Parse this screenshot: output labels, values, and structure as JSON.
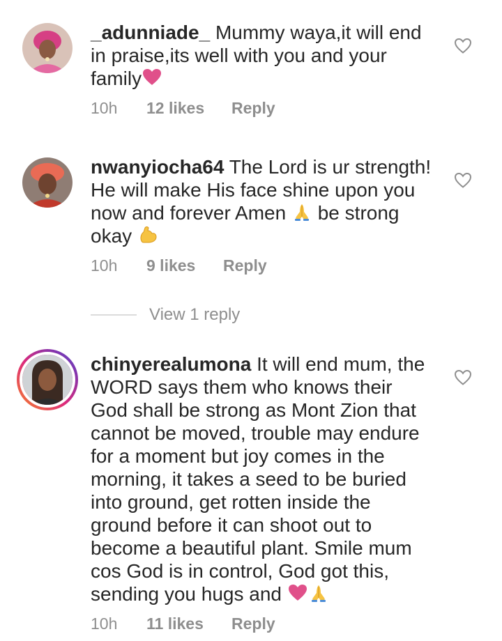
{
  "comments": [
    {
      "username": "_adunniade_",
      "text": "Mummy waya,it will end in praise,its well with you and your family",
      "time": "10h",
      "likes": "12 likes",
      "reply": "Reply"
    },
    {
      "username": "nwanyiocha64",
      "text_a": "The Lord is ur strength! He will make His face shine upon you now and forever Amen",
      "text_b": "be strong okay",
      "time": "10h",
      "likes": "9 likes",
      "reply": "Reply",
      "view_replies": "View 1 reply"
    },
    {
      "username": "chinyerealumona",
      "text": "It will end mum, the WORD says them who knows their God shall be strong as Mont Zion that cannot be moved, trouble may endure for a moment but joy comes in the morning, it takes a seed to be buried into ground, get rotten inside the ground before it can shoot out to become a beautiful plant. Smile mum cos God is in control, God got this, sending you hugs and",
      "time": "10h",
      "likes": "11 likes",
      "reply": "Reply"
    }
  ],
  "icons": {
    "like": "heart-outline-icon",
    "heart_emoji": "heart-emoji",
    "pray_emoji": "folded-hands-emoji",
    "muscle_emoji": "flexed-biceps-emoji"
  },
  "colors": {
    "text": "#262626",
    "muted": "#8e8e8e",
    "heart_emoji": "#e0508a",
    "story_ring": "#dd2a7b"
  }
}
